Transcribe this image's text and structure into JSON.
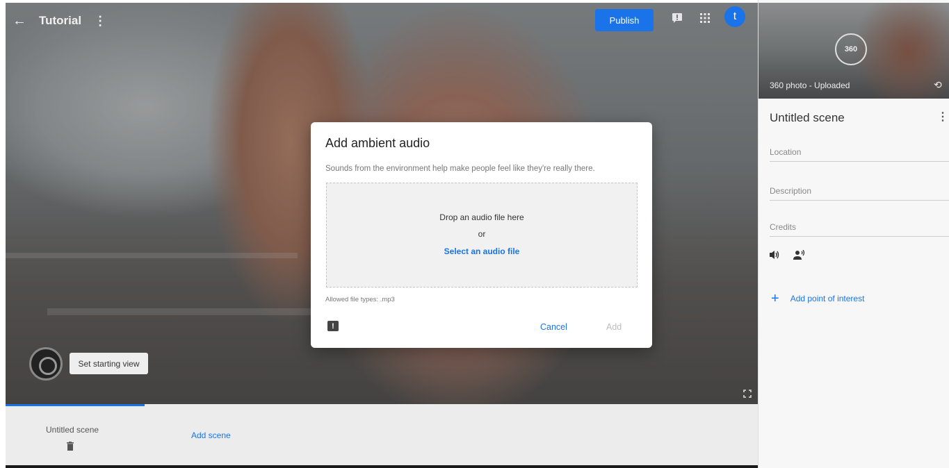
{
  "topbar": {
    "back_icon": "arrow-left-icon",
    "title": "Tutorial",
    "menu_icon": "more-vert-icon",
    "publish_label": "Publish",
    "feedback_icon": "feedback-icon",
    "apps_icon": "apps-grid-icon",
    "avatar_letter": "t"
  },
  "viewer": {
    "set_starting_view_label": "Set starting view",
    "fullscreen_icon": "fullscreen-icon"
  },
  "scenes": {
    "items": [
      {
        "name": "Untitled scene",
        "delete_icon": "trash-icon"
      }
    ],
    "add_scene_label": "Add scene"
  },
  "panel": {
    "thumbnail_label": "360 photo - Uploaded",
    "badge_360": "360",
    "scene_title": "Untitled scene",
    "location_placeholder": "Location",
    "description_placeholder": "Description",
    "credits_placeholder": "Credits",
    "audio_icon": "volume-icon",
    "narration_icon": "record-voice-icon",
    "add_poi_label": "Add point of interest"
  },
  "modal": {
    "title": "Add ambient audio",
    "description": "Sounds from the environment help make people feel like they're really there.",
    "drop_text": "Drop an audio file here",
    "or_text": "or",
    "select_link": "Select an audio file",
    "allowed_types": "Allowed file types: .mp3",
    "cancel_label": "Cancel",
    "add_label": "Add",
    "accent_color": "#1a73e8"
  }
}
